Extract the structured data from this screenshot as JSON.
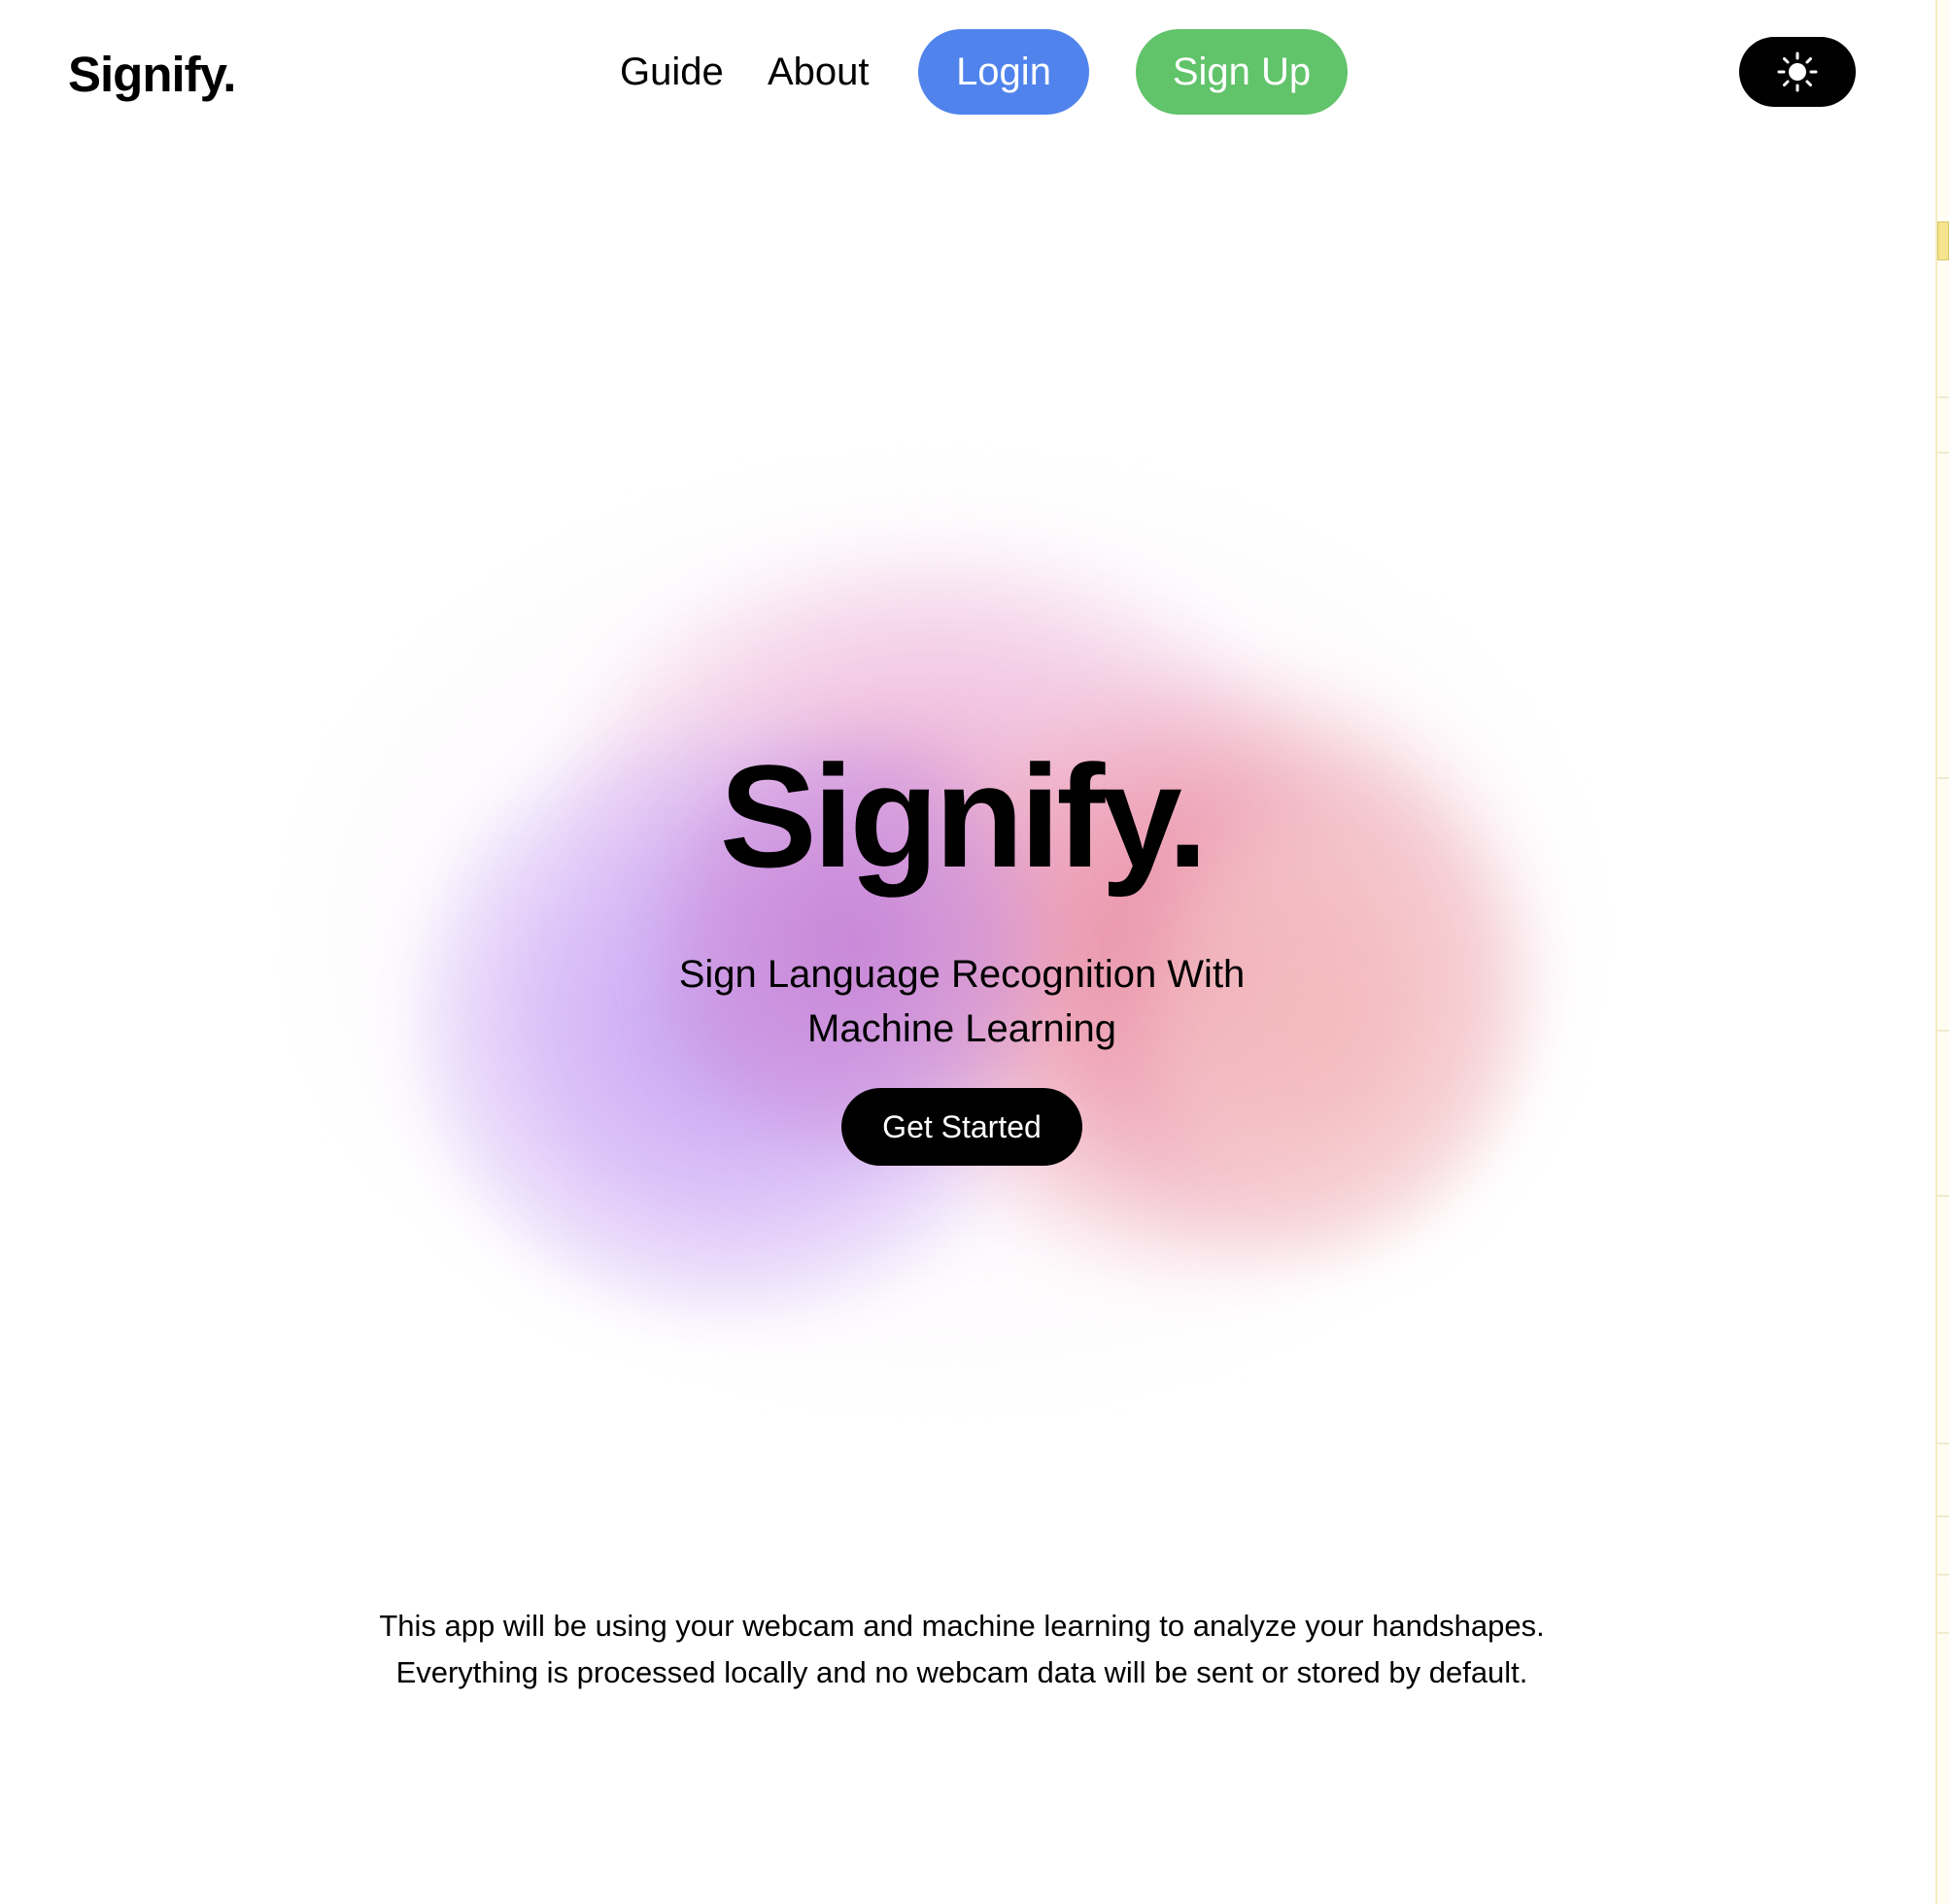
{
  "header": {
    "logo": "Signify.",
    "nav": {
      "guide_label": "Guide",
      "about_label": "About",
      "login_label": "Login",
      "signup_label": "Sign Up"
    },
    "theme_toggle_icon": "sun-icon"
  },
  "hero": {
    "title": "Signify.",
    "subtitle": "Sign Language Recognition With Machine Learning",
    "cta_label": "Get Started"
  },
  "disclaimer": {
    "line1": "This app will be using your webcam and machine learning to analyze your handshapes.",
    "line2": "Everything is processed locally and no webcam data will be sent or stored by default."
  },
  "colors": {
    "login": "#5083ec",
    "signup": "#61c36a",
    "toggle_bg": "#000000",
    "cta_bg": "#000000",
    "blob_purple": "#cfb0f4",
    "blob_pink": "#ecb8d8",
    "blob_red": "#e6899c"
  }
}
